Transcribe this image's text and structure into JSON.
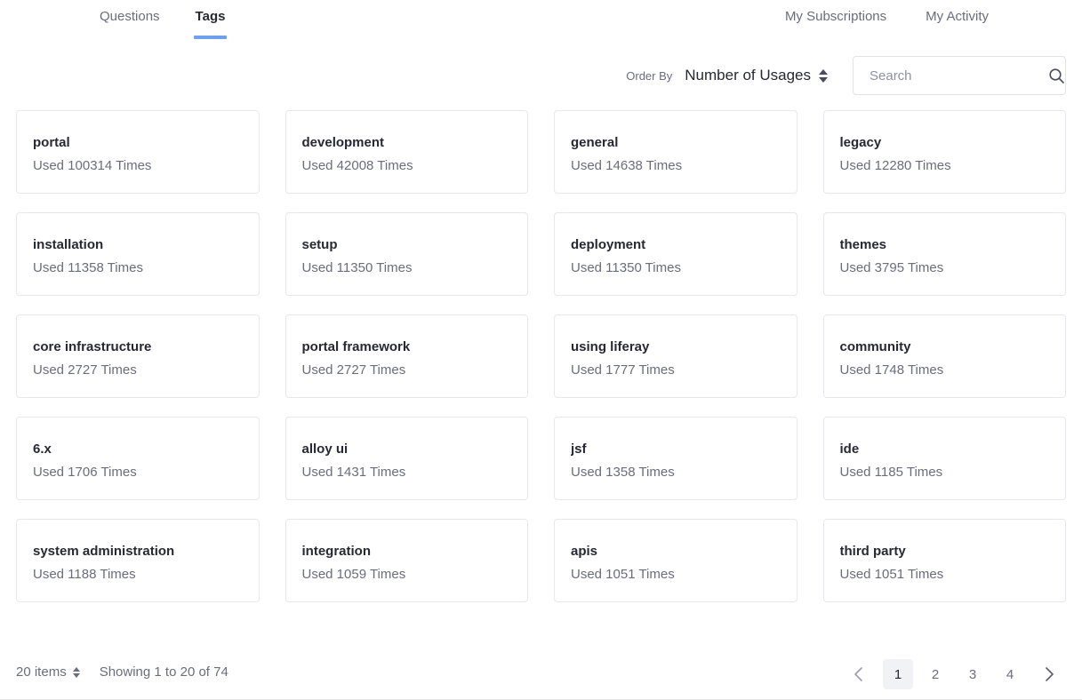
{
  "nav": {
    "left_items": [
      {
        "label": "Questions",
        "active": false
      },
      {
        "label": "Tags",
        "active": true
      }
    ],
    "right_items": [
      {
        "label": "My Subscriptions"
      },
      {
        "label": "My Activity"
      }
    ]
  },
  "toolbar": {
    "order_by_label": "Order By",
    "order_by_value": "Number of Usages",
    "sort_icon": "sort-updown-icon",
    "search_placeholder": "Search",
    "search_value": "",
    "search_icon": "search-icon"
  },
  "tags": [
    {
      "name": "portal",
      "usage": "Used 100314 Times"
    },
    {
      "name": "development",
      "usage": "Used 42008 Times"
    },
    {
      "name": "general",
      "usage": "Used 14638 Times"
    },
    {
      "name": "legacy",
      "usage": "Used 12280 Times"
    },
    {
      "name": "installation",
      "usage": "Used 11358 Times"
    },
    {
      "name": "setup",
      "usage": "Used 11350 Times"
    },
    {
      "name": "deployment",
      "usage": "Used 11350 Times"
    },
    {
      "name": "themes",
      "usage": "Used 3795 Times"
    },
    {
      "name": "core infrastructure",
      "usage": "Used 2727 Times"
    },
    {
      "name": "portal framework",
      "usage": "Used 2727 Times"
    },
    {
      "name": "using liferay",
      "usage": "Used 1777 Times"
    },
    {
      "name": "community",
      "usage": "Used 1748 Times"
    },
    {
      "name": "6.x",
      "usage": "Used 1706 Times"
    },
    {
      "name": "alloy ui",
      "usage": "Used 1431 Times"
    },
    {
      "name": "jsf",
      "usage": "Used 1358 Times"
    },
    {
      "name": "ide",
      "usage": "Used 1185 Times"
    },
    {
      "name": "system administration",
      "usage": "Used 1188 Times"
    },
    {
      "name": "integration",
      "usage": "Used 1059 Times"
    },
    {
      "name": "apis",
      "usage": "Used 1051 Times"
    },
    {
      "name": "third party",
      "usage": "Used 1051 Times"
    }
  ],
  "footer": {
    "items_per_page": "20 items",
    "items_per_page_icon": "sort-updown-icon",
    "showing_text": "Showing 1 to 20 of 74",
    "prev_icon": "chevron-left-icon",
    "next_icon": "chevron-right-icon",
    "pages": [
      {
        "label": "1",
        "active": true
      },
      {
        "label": "2",
        "active": false
      },
      {
        "label": "3",
        "active": false
      },
      {
        "label": "4",
        "active": false
      }
    ]
  },
  "colors": {
    "accent": "#6ea0ef",
    "text_dark": "#272833",
    "text_muted": "#6b6c7e",
    "border": "#e7e7ed",
    "active_page_bg": "#f1f2f5"
  }
}
